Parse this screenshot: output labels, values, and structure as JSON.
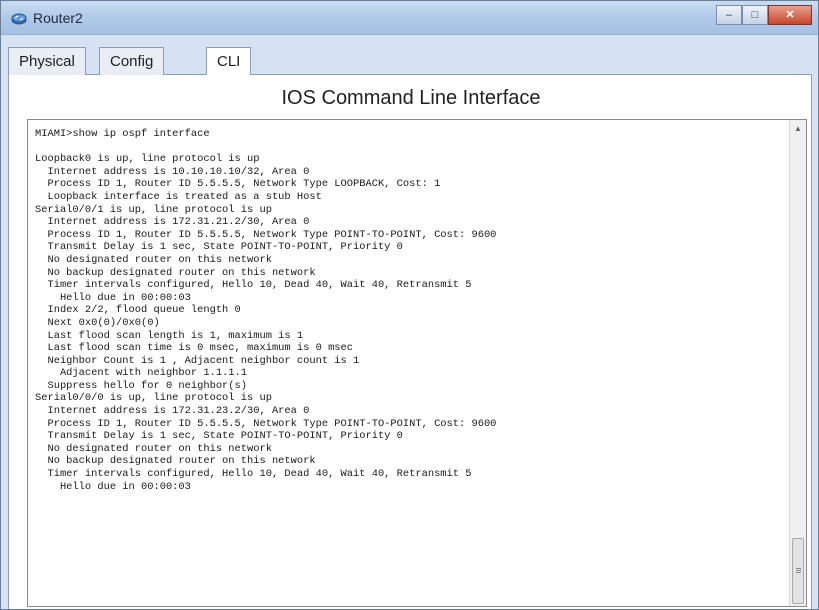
{
  "window": {
    "title": "Router2",
    "icon": "router-icon",
    "controls": {
      "minimize": "–",
      "maximize": "□",
      "close": "✕"
    }
  },
  "tabs": [
    {
      "label": "Physical",
      "active": false
    },
    {
      "label": "Config",
      "active": false
    },
    {
      "label": "CLI",
      "active": true
    }
  ],
  "cli": {
    "heading": "IOS Command Line Interface",
    "lines": [
      "MIAMI>show ip ospf interface",
      "",
      "Loopback0 is up, line protocol is up",
      "  Internet address is 10.10.10.10/32, Area 0",
      "  Process ID 1, Router ID 5.5.5.5, Network Type LOOPBACK, Cost: 1",
      "  Loopback interface is treated as a stub Host",
      "Serial0/0/1 is up, line protocol is up",
      "  Internet address is 172.31.21.2/30, Area 0",
      "  Process ID 1, Router ID 5.5.5.5, Network Type POINT-TO-POINT, Cost: 9600",
      "  Transmit Delay is 1 sec, State POINT-TO-POINT, Priority 0",
      "  No designated router on this network",
      "  No backup designated router on this network",
      "  Timer intervals configured, Hello 10, Dead 40, Wait 40, Retransmit 5",
      "    Hello due in 00:00:03",
      "  Index 2/2, flood queue length 0",
      "  Next 0x0(0)/0x0(0)",
      "  Last flood scan length is 1, maximum is 1",
      "  Last flood scan time is 0 msec, maximum is 0 msec",
      "  Neighbor Count is 1 , Adjacent neighbor count is 1",
      "    Adjacent with neighbor 1.1.1.1",
      "  Suppress hello for 0 neighbor(s)",
      "Serial0/0/0 is up, line protocol is up",
      "  Internet address is 172.31.23.2/30, Area 0",
      "  Process ID 1, Router ID 5.5.5.5, Network Type POINT-TO-POINT, Cost: 9600",
      "  Transmit Delay is 1 sec, State POINT-TO-POINT, Priority 0",
      "  No designated router on this network",
      "  No backup designated router on this network",
      "  Timer intervals configured, Hello 10, Dead 40, Wait 40, Retransmit 5",
      "    Hello due in 00:00:03"
    ]
  },
  "colors": {
    "titlebar": "#b3cbe9",
    "close_button": "#c8452b",
    "terminal_text": "#1a1a1a"
  }
}
